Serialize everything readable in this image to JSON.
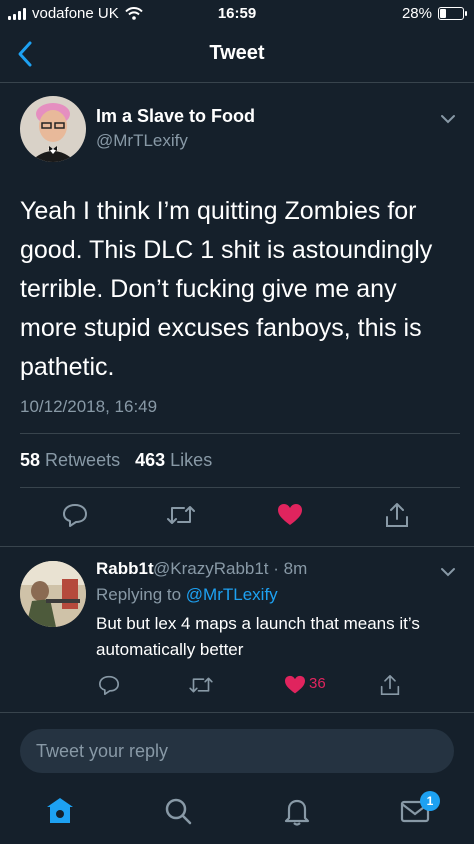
{
  "status_bar": {
    "carrier": "vodafone UK",
    "time": "16:59",
    "battery": "28%",
    "battery_level": 0.28
  },
  "nav": {
    "title": "Tweet"
  },
  "tweet": {
    "author_name": "Im a Slave to Food",
    "author_handle": "@MrTLexify",
    "text": "Yeah I think I’m quitting Zombies for good. This DLC 1 shit is astoundingly terrible. Don’t fucking give me any more stupid excuses fanboys, this is pathetic.",
    "timestamp": "10/12/2018, 16:49",
    "retweet_count": "58",
    "retweets_label": "Retweets",
    "like_count": "463",
    "likes_label": "Likes"
  },
  "reply": {
    "name": "Rabb1t",
    "handle_time": "@KrazyRabb1t · 8m",
    "replying_label": "Replying to",
    "replying_handle": "@MrTLexify",
    "text": "But but lex 4 maps a launch that means it’s automatically better",
    "like_count": "36"
  },
  "compose": {
    "placeholder": "Tweet your reply"
  },
  "tab_bar": {
    "messages_badge": "1"
  },
  "colors": {
    "background": "#15202b",
    "accent": "#1da1f2",
    "like": "#e0245e",
    "secondary_text": "#8899a6",
    "divider": "#38444d"
  }
}
